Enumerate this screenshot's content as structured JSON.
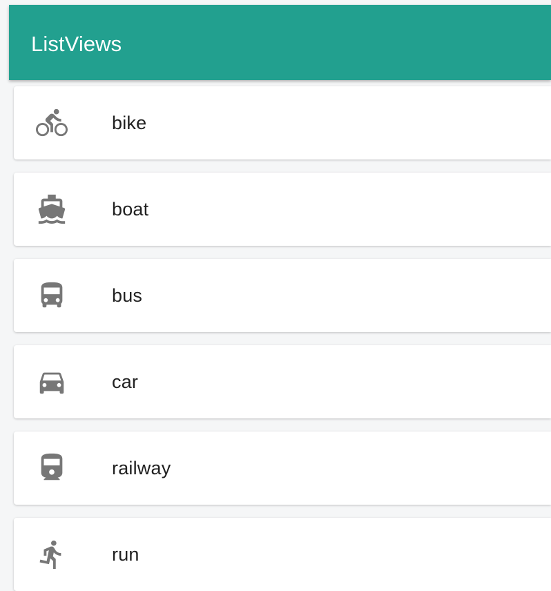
{
  "app_bar": {
    "title": "ListViews",
    "color": "#22a08f"
  },
  "items": [
    {
      "label": "bike",
      "icon": "bike-icon"
    },
    {
      "label": "boat",
      "icon": "boat-icon"
    },
    {
      "label": "bus",
      "icon": "bus-icon"
    },
    {
      "label": "car",
      "icon": "car-icon"
    },
    {
      "label": "railway",
      "icon": "railway-icon"
    },
    {
      "label": "run",
      "icon": "run-icon"
    }
  ]
}
